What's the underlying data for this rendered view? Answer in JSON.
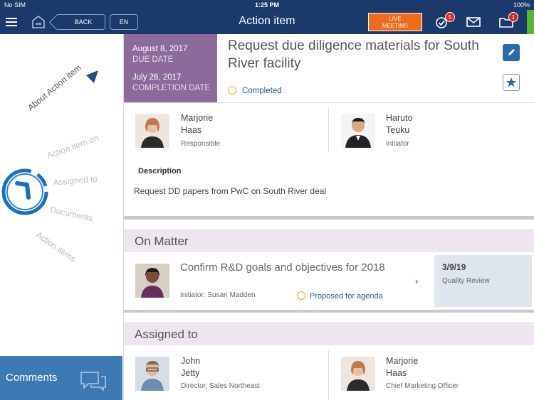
{
  "status_bar": {
    "carrier": "No SIM",
    "time": "1:25 PM",
    "battery": "100%"
  },
  "nav": {
    "back_label": "BACK",
    "lang_label": "EN",
    "title": "Action item",
    "live_meeting_label": "LIVE\nMEETING",
    "tasks_badge": "5",
    "folder_badge": "1"
  },
  "sidebar": {
    "wheel_items": [
      "About Action item",
      "Action item on",
      "Assigned to",
      "Documents",
      "Action items"
    ],
    "comments_label": "Comments"
  },
  "action_item": {
    "due_date": "August 8, 2017",
    "due_date_label": "DUE DATE",
    "completion_date": "July 26, 2017",
    "completion_date_label": "COMPLETION DATE",
    "title": "Request due diligence materials for South River facility",
    "status": "Completed",
    "responsible": {
      "first": "Marjorie",
      "last": "Haas",
      "role": "Responsible"
    },
    "initiator": {
      "first": "Haruto",
      "last": "Teuku",
      "role": "Initiator"
    },
    "description_heading": "Description",
    "description": "Request DD papers from PwC on South River deal"
  },
  "on_matter": {
    "heading": "On Matter",
    "title": "Confirm R&D goals and objectives for 2018",
    "initiator": "Initiator: Susan Madden",
    "status": "Proposed for agenda",
    "meeting_date": "3/9/19",
    "meeting_type": "Quality Review"
  },
  "assigned_to": {
    "heading": "Assigned to",
    "people": [
      {
        "first": "John",
        "last": "Jetty",
        "title": "Director, Sales Northeast"
      },
      {
        "first": "Marjorie",
        "last": "Haas",
        "title": "Chief Marketing Officer"
      }
    ]
  },
  "colors": {
    "nav": "#1b3a6b",
    "date_box": "#8c6a9c",
    "live": "#f26a1b",
    "comments": "#3d79b3",
    "accent": "#2a5b8f"
  }
}
